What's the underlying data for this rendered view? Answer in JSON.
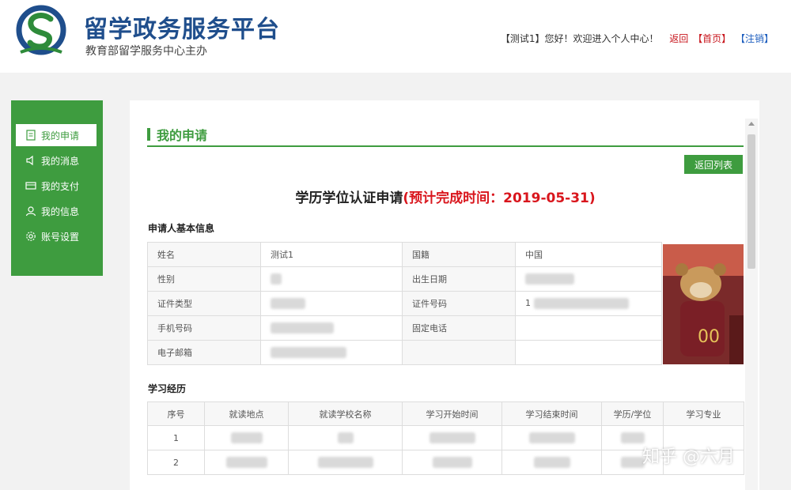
{
  "header": {
    "title": "留学政务服务平台",
    "subtitle": "教育部留学服务中心主办",
    "user_text": "【测试1】您好！欢迎进入个人中心！",
    "return_link": "返回",
    "home_link": "【首页】",
    "logout_link": "【注销】"
  },
  "sidebar": {
    "items": [
      {
        "label": "我的申请",
        "icon": "document-icon"
      },
      {
        "label": "我的消息",
        "icon": "speaker-icon"
      },
      {
        "label": "我的支付",
        "icon": "card-icon"
      },
      {
        "label": "我的信息",
        "icon": "user-icon"
      },
      {
        "label": "账号设置",
        "icon": "gear-icon"
      }
    ]
  },
  "main": {
    "section_title": "我的申请",
    "back_button": "返回列表",
    "app_title": "学历学位认证申请",
    "app_title_note": "(预计完成时间：2019-05-31)",
    "basic_info_title": "申请人基本信息",
    "basic_info": {
      "name_label": "姓名",
      "name_value": "测试1",
      "nationality_label": "国籍",
      "nationality_value": "中国",
      "gender_label": "性别",
      "birth_label": "出生日期",
      "id_type_label": "证件类型",
      "id_no_label": "证件号码",
      "id_no_value": "1",
      "mobile_label": "手机号码",
      "phone_label": "固定电话",
      "email_label": "电子邮箱"
    },
    "study_title": "学习经历",
    "study_columns": [
      "序号",
      "就读地点",
      "就读学校名称",
      "学习开始时间",
      "学习结束时间",
      "学历/学位",
      "学习专业"
    ],
    "study_rows": [
      {
        "no": "1"
      },
      {
        "no": "2"
      }
    ]
  },
  "watermark": "知乎 @六月",
  "colors": {
    "brand_green": "#3e9c3f",
    "title_blue": "#1f4e8c",
    "accent_red": "#d9161d"
  }
}
